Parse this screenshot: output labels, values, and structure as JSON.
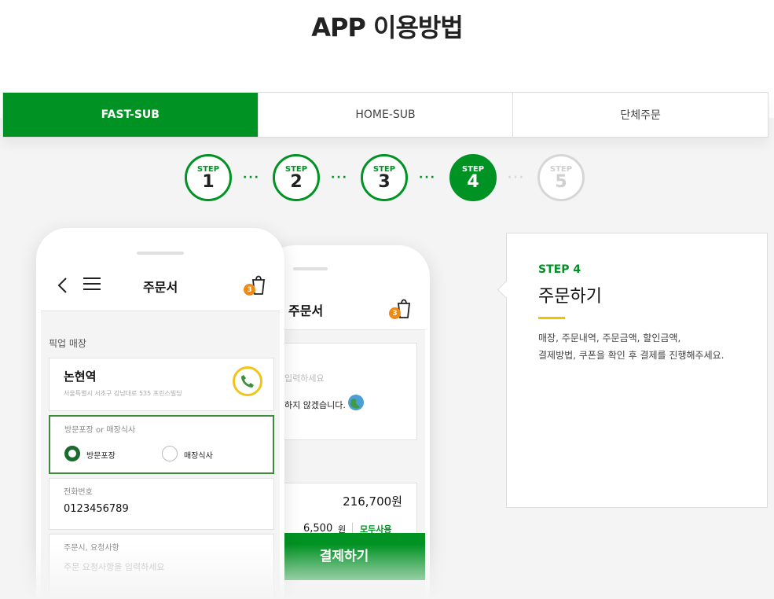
{
  "page": {
    "title": "APP 이용방법"
  },
  "tabs": [
    {
      "label": "FAST-SUB",
      "active": true
    },
    {
      "label": "HOME-SUB",
      "active": false
    },
    {
      "label": "단체주문",
      "active": false
    }
  ],
  "steps": {
    "label": "STEP",
    "items": [
      {
        "number": "1",
        "state": "done"
      },
      {
        "number": "2",
        "state": "done"
      },
      {
        "number": "3",
        "state": "done"
      },
      {
        "number": "4",
        "state": "active"
      },
      {
        "number": "5",
        "state": "disabled"
      }
    ],
    "separator": "···"
  },
  "phone_front": {
    "title": "주문서",
    "cart_count": "3",
    "pickup_label": "픽업 매장",
    "store_name": "논현역",
    "store_address": "서울특별시 서초구 강남대로 535 프린스빌딩",
    "dine_label": "방문포장 or 매장식사",
    "options": [
      "방문포장",
      "매장식사"
    ],
    "selected_option": "방문포장",
    "phone_label": "전화번호",
    "phone_value": "0123456789",
    "request_label": "주문시, 요청사항",
    "request_placeholder": "주문 요청사항을 입력하세요"
  },
  "phone_back": {
    "title": "주문서",
    "cart_count": "3",
    "input_placeholder": "입력하세요",
    "opt_out_text": "하지 않겠습니다.",
    "total_amount": "216,700원",
    "point_value": "6,500",
    "point_unit": "원",
    "use_all_label": "모두사용",
    "pay_button": "결제하기"
  },
  "info": {
    "step_label": "STEP 4",
    "title": "주문하기",
    "description_lines": [
      "매장, 주문내역, 주문금액, 할인금액,",
      "결제방법, 쿠폰을 확인 후 결제를 진행해주세요."
    ]
  },
  "colors": {
    "brand_green": "#009223",
    "accent_yellow": "#f2c200",
    "badge_orange": "#f08a14"
  }
}
